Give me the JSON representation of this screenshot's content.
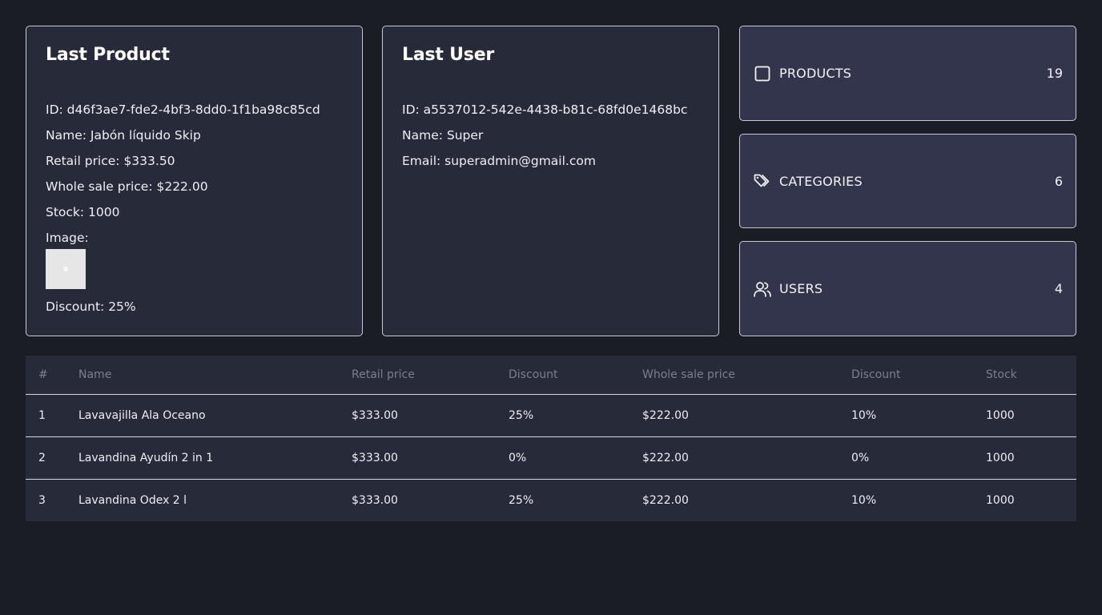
{
  "product_card": {
    "title": "Last Product",
    "id": "ID: d46f3ae7-fde2-4bf3-8dd0-1f1ba98c85cd",
    "name": "Name: Jabón líquido Skip",
    "retail_price": "Retail price: $333.50",
    "wholesale_price": "Whole sale price: $222.00",
    "stock": "Stock: 1000",
    "image_label": "Image:",
    "discount": "Discount: 25%"
  },
  "user_card": {
    "title": "Last User",
    "id": "ID: a5537012-542e-4438-b81c-68fd0e1468bc",
    "name": "Name: Super",
    "email": "Email: superadmin@gmail.com"
  },
  "stats": {
    "products": {
      "label": "PRODUCTS",
      "count": "19",
      "icon": "square-icon"
    },
    "categories": {
      "label": "CATEGORIES",
      "count": "6",
      "icon": "tags-icon"
    },
    "users": {
      "label": "USERS",
      "count": "4",
      "icon": "users-icon"
    }
  },
  "table": {
    "headers": [
      "#",
      "Name",
      "Retail price",
      "Discount",
      "Whole sale price",
      "Discount",
      "Stock"
    ],
    "rows": [
      [
        "1",
        "Lavavajilla Ala Oceano",
        "$333.00",
        "25%",
        "$222.00",
        "10%",
        "1000"
      ],
      [
        "2",
        "Lavandina Ayudín 2 in 1",
        "$333.00",
        "0%",
        "$222.00",
        "0%",
        "1000"
      ],
      [
        "3",
        "Lavandina Odex 2 l",
        "$333.00",
        "25%",
        "$222.00",
        "10%",
        "1000"
      ]
    ]
  },
  "colors": {
    "page_bg": "#1b1d25",
    "card_bg": "#262a39",
    "stat_bg": "#33354c",
    "border": "#c9cbd3",
    "header_text": "#7b7f8d"
  }
}
